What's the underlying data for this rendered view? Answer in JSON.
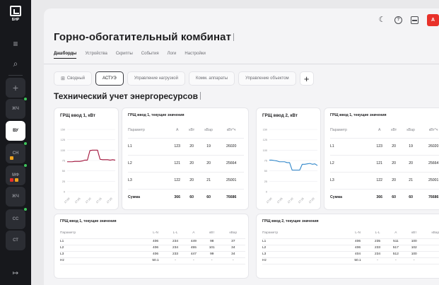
{
  "app": {
    "logo_text": "БНР",
    "rail_items": [
      {
        "label": "ЖЧ"
      },
      {
        "label": "ВУ"
      },
      {
        "label": "СН"
      },
      {
        "label": "МФ"
      },
      {
        "label": "ЖЧ"
      },
      {
        "label": "СС"
      },
      {
        "label": "СТ"
      }
    ]
  },
  "header": {
    "title": "Горно-обогатительный комбинат",
    "avatar": "А"
  },
  "nav": {
    "tabs": [
      "Дашборды",
      "Устройства",
      "Скрипты",
      "События",
      "Логи",
      "Настройки"
    ],
    "active": 0
  },
  "subtabs": {
    "items": [
      "Сводный",
      "АСТУЭ",
      "Управление нагрузкой",
      "Комм. аппараты",
      "Управление объектом"
    ],
    "active": 1,
    "add_label": "+"
  },
  "section": {
    "title": "Технический учет энергоресурсов"
  },
  "colors": {
    "chart1_line": "#a2123a",
    "chart2_line": "#2f86c9",
    "avatar": "#e8312a"
  },
  "chart_data": [
    {
      "type": "line",
      "title": "ГРЩ ввод 1, кВт",
      "x": [
        "17:00",
        "17:05",
        "17:10",
        "17:15",
        "17:20"
      ],
      "series": [
        {
          "values": [
            72,
            72,
            72,
            73,
            73,
            73,
            74,
            76,
            76,
            99,
            100,
            100,
            100,
            78,
            77,
            77,
            77,
            76,
            77,
            76
          ]
        }
      ],
      "yticks": [
        "150",
        "125",
        "100",
        "75",
        "50",
        "25",
        "0"
      ],
      "ylim": [
        0,
        150
      ],
      "grid": true
    },
    {
      "type": "line",
      "title": "ГРЩ ввод 2, кВт",
      "x": [
        "17:00",
        "17:05",
        "17:10",
        "17:15",
        "17:20"
      ],
      "series": [
        {
          "values": [
            76,
            76,
            75,
            74,
            72,
            72,
            72,
            70,
            70,
            52,
            52,
            52,
            52,
            66,
            66,
            67,
            68,
            66,
            67,
            63
          ]
        }
      ],
      "yticks": [
        "150",
        "125",
        "100",
        "75",
        "50",
        "25",
        "0"
      ],
      "ylim": [
        0,
        150
      ],
      "grid": true
    }
  ],
  "table_small_1": {
    "title": "ГРЩ ввод 1, текущие значения",
    "headers": [
      "Параметр",
      "А",
      "кВт",
      "кВар",
      "кВт*ч"
    ],
    "rows": [
      [
        "L1",
        "123",
        "20",
        "19",
        "26020"
      ],
      [
        "L2",
        "121",
        "20",
        "20",
        "25664"
      ],
      [
        "L3",
        "122",
        "20",
        "21",
        "25001"
      ],
      [
        "Сумма",
        "366",
        "60",
        "60",
        "76686"
      ]
    ]
  },
  "table_small_2": {
    "title": "ГРЩ ввод 1, текущие значения",
    "headers": [
      "Параметр",
      "А",
      "кВт",
      "кВар",
      "кВт*ч"
    ],
    "rows": [
      [
        "L1",
        "123",
        "20",
        "19",
        "26020"
      ],
      [
        "L2",
        "121",
        "20",
        "20",
        "25664"
      ],
      [
        "L3",
        "122",
        "20",
        "21",
        "25001"
      ],
      [
        "Сумма",
        "366",
        "60",
        "60",
        "76686"
      ]
    ]
  },
  "table_big_1": {
    "title": "ГРЩ ввод 1, текущие значения",
    "headers": [
      "Параметр",
      "L-N",
      "L-L",
      "А",
      "кВт",
      "кВар"
    ],
    "rows": [
      [
        "L1",
        "406",
        "234",
        "449",
        "98",
        "37"
      ],
      [
        "L2",
        "406",
        "234",
        "455",
        "101",
        "34"
      ],
      [
        "L3",
        "406",
        "233",
        "447",
        "99",
        "34"
      ],
      [
        "Hz",
        "50.1",
        "-",
        "-",
        "-",
        "-"
      ]
    ]
  },
  "table_big_2": {
    "title": "ГРЩ ввод 2, текущие значения",
    "headers": [
      "Параметр",
      "L-N",
      "L-L",
      "А",
      "кВт",
      "кВар"
    ],
    "rows": [
      [
        "L1",
        "406",
        "235",
        "511",
        "100",
        ""
      ],
      [
        "L2",
        "406",
        "233",
        "517",
        "102",
        ""
      ],
      [
        "L3",
        "404",
        "234",
        "512",
        "100",
        ""
      ],
      [
        "Hz",
        "50.1",
        "-",
        "-",
        "-",
        ""
      ]
    ]
  }
}
